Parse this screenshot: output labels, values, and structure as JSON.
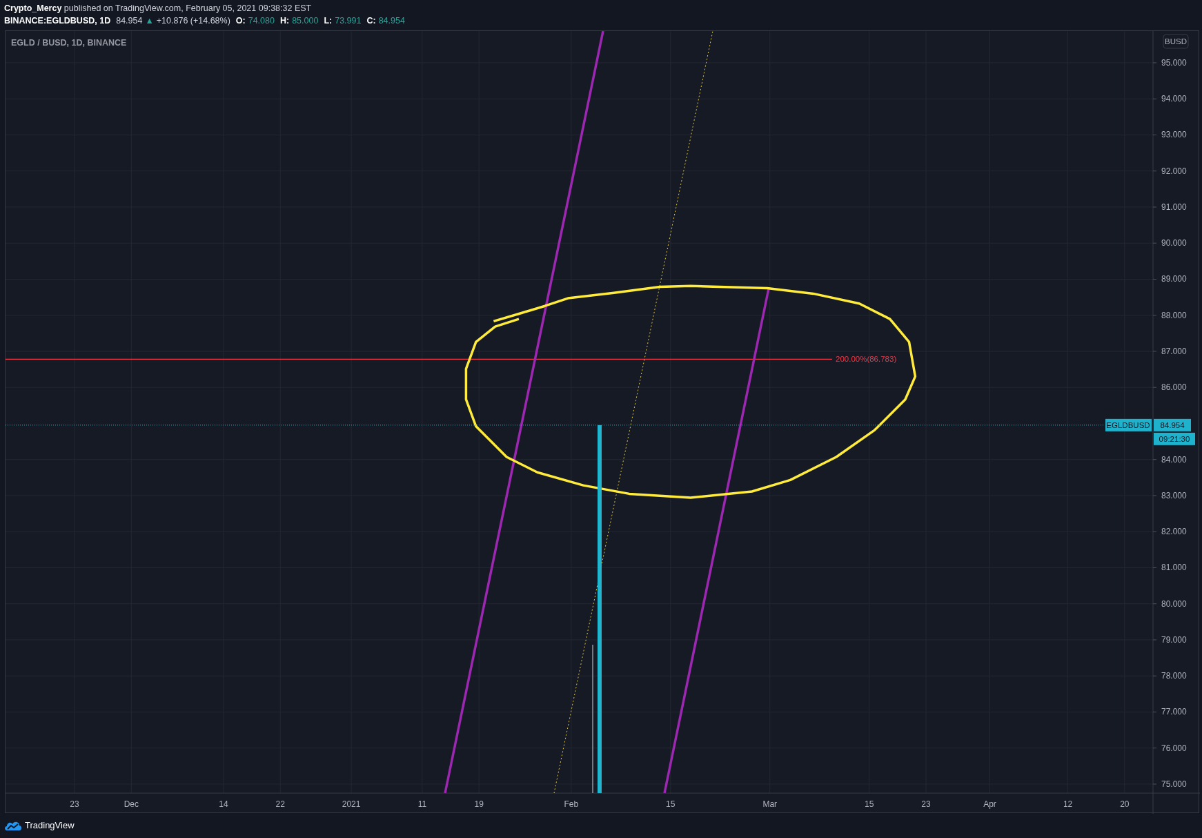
{
  "header": {
    "author": "Crypto_Mercy",
    "published": "published on TradingView.com, February 05, 2021 09:38:32 EST"
  },
  "symbol_bar": {
    "symbol": "BINANCE:EGLDBUSD, 1D",
    "last": "84.954",
    "arrow": "▲",
    "change": "+10.876 (+14.68%)",
    "ohlc": [
      {
        "label": "O:",
        "value": "74.080"
      },
      {
        "label": "H:",
        "value": "85.000"
      },
      {
        "label": "L:",
        "value": "73.991"
      },
      {
        "label": "C:",
        "value": "84.954"
      }
    ]
  },
  "chart": {
    "legend": "EGLD / BUSD, 1D, BINANCE",
    "currency": "BUSD",
    "price_tag": {
      "symbol": "EGLDBUSD",
      "price": "84.954",
      "countdown": "09:21:30"
    },
    "level_label": "200.00%(86.783)",
    "price_axis": [
      "95.000",
      "94.000",
      "93.000",
      "92.000",
      "91.000",
      "90.000",
      "89.000",
      "88.000",
      "87.000",
      "86.000",
      "84.000",
      "83.000",
      "82.000",
      "81.000",
      "80.000",
      "79.000",
      "78.000",
      "77.000",
      "76.000",
      "75.000"
    ],
    "time_axis": [
      "23",
      "Dec",
      "14",
      "22",
      "2021",
      "11",
      "19",
      "Feb",
      "15",
      "Mar",
      "15",
      "23",
      "Apr",
      "12",
      "20"
    ]
  },
  "footer": {
    "brand": "TradingView"
  }
}
